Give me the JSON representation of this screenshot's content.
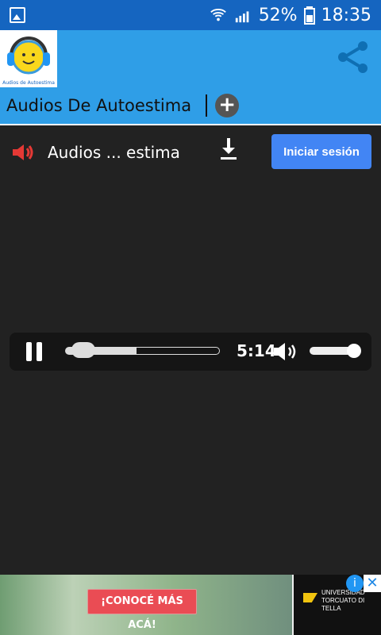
{
  "statusbar": {
    "battery": "52%",
    "time": "18:35"
  },
  "header": {
    "app_title": "Audios De Autoestima",
    "logo_text": "Audios de Autoestima"
  },
  "main": {
    "audio_title": "Audios ... estima",
    "signin_label": "Iniciar sesión"
  },
  "player": {
    "time": "5:14",
    "progress": 0.46,
    "volume": 1
  },
  "ad": {
    "cta": "¡CONOCÉ MÁS ACÁ!",
    "brand_line1": "UNIVERSIDAD",
    "brand_line2": "TORCUATO DI TELLA",
    "info": "i",
    "close": "✕"
  },
  "colors": {
    "statusbar": "#1565c0",
    "header": "#2f9ee7",
    "signin": "#4285f4",
    "background": "#222222",
    "ad_cta": "#ea4c54"
  },
  "icons": {
    "status_left": "image-icon",
    "wifi": "wifi-icon",
    "signal": "signal-icon",
    "battery": "battery-icon",
    "share": "share-icon",
    "plus": "plus-icon",
    "speaker": "speaker-icon",
    "download": "download-icon",
    "pause": "pause-icon",
    "volume": "volume-icon"
  }
}
